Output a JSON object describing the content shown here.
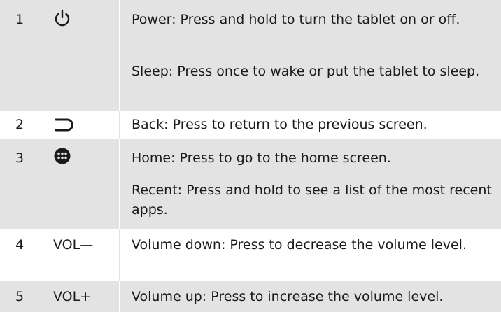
{
  "rows": [
    {
      "number": "1",
      "key_icon": "power-icon",
      "descriptions": [
        "Power: Press and hold to turn the tablet on or off.",
        "Sleep: Press once to wake or put the tablet to sleep."
      ]
    },
    {
      "number": "2",
      "key_icon": "back-icon",
      "descriptions": [
        "Back: Press to return to the previous screen."
      ]
    },
    {
      "number": "3",
      "key_icon": "home-icon",
      "descriptions": [
        "Home: Press to go to the home screen.",
        "Recent: Press and hold to see a list of the most recent apps."
      ]
    },
    {
      "number": "4",
      "key": "VOL—",
      "descriptions": [
        "Volume down: Press to decrease the volume level."
      ]
    },
    {
      "number": "5",
      "key": "VOL+",
      "descriptions": [
        "Volume up: Press to increase the volume level."
      ]
    }
  ],
  "colors": {
    "shaded_row": "#e3e3e3",
    "plain_row": "#ffffff",
    "text": "#1a1a1a"
  }
}
